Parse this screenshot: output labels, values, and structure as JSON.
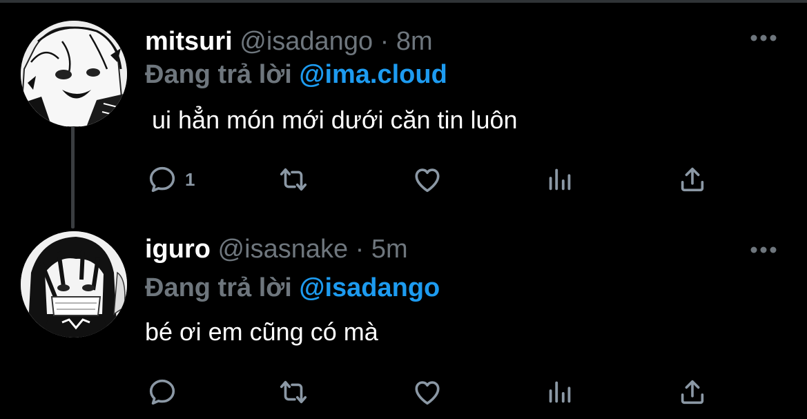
{
  "tweets": [
    {
      "name": "mitsuri",
      "handle": "@isadango",
      "separator": "·",
      "time": "8m",
      "replying_prefix": "Đang trả lời",
      "replying_to": "@ima.cloud",
      "text": " ui hẳn món mới dưới căn tin luôn",
      "reply_count": "1",
      "avatar_icon": "anime-avatar-mitsuri"
    },
    {
      "name": "iguro",
      "handle": "@isasnake",
      "separator": "·",
      "time": "5m",
      "replying_prefix": "Đang trả lời",
      "replying_to": "@isadango",
      "text": "bé ơi em cũng có mà",
      "reply_count": "",
      "avatar_icon": "anime-avatar-iguro"
    }
  ],
  "icons": {
    "more": "more-horizontal-icon",
    "reply": "reply-icon",
    "retweet": "retweet-icon",
    "like": "heart-icon",
    "analytics": "analytics-icon",
    "share": "share-icon"
  },
  "colors": {
    "background": "#000000",
    "text": "#ffffff",
    "secondary": "#6e767d",
    "mention": "#1d9bf0",
    "icon": "#8b98a5"
  }
}
